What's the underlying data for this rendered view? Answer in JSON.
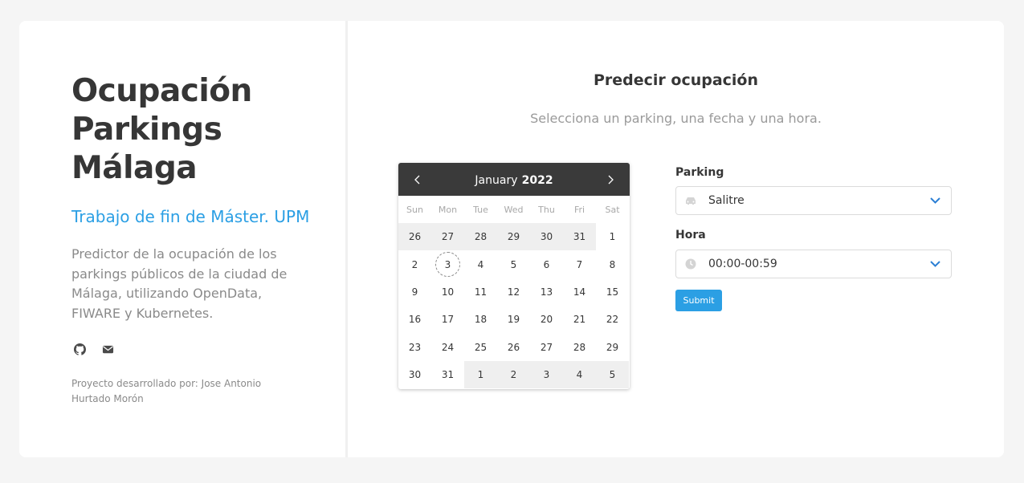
{
  "left": {
    "title": "Ocupación Parkings Málaga",
    "subtitle": "Trabajo de fin de Máster. UPM",
    "description": "Predictor de la ocupación de los parkings públicos de la ciudad de Málaga, utilizando OpenData, FIWARE y Kubernetes.",
    "icons": [
      "github-icon",
      "mail-icon"
    ],
    "credit": "Proyecto desarrollado por: Jose Antonio Hurtado Morón"
  },
  "main": {
    "title": "Predecir ocupación",
    "subtitle": "Selecciona un parking, una fecha y una hora."
  },
  "calendar": {
    "month": "January",
    "year": "2022",
    "weekdays": [
      "Sun",
      "Mon",
      "Tue",
      "Wed",
      "Thu",
      "Fri",
      "Sat"
    ],
    "days": [
      {
        "d": "26",
        "other": true
      },
      {
        "d": "27",
        "other": true
      },
      {
        "d": "28",
        "other": true
      },
      {
        "d": "29",
        "other": true
      },
      {
        "d": "30",
        "other": true
      },
      {
        "d": "31",
        "other": true
      },
      {
        "d": "1"
      },
      {
        "d": "2"
      },
      {
        "d": "3",
        "today": true
      },
      {
        "d": "4"
      },
      {
        "d": "5"
      },
      {
        "d": "6"
      },
      {
        "d": "7"
      },
      {
        "d": "8"
      },
      {
        "d": "9"
      },
      {
        "d": "10"
      },
      {
        "d": "11"
      },
      {
        "d": "12"
      },
      {
        "d": "13"
      },
      {
        "d": "14"
      },
      {
        "d": "15"
      },
      {
        "d": "16"
      },
      {
        "d": "17"
      },
      {
        "d": "18"
      },
      {
        "d": "19"
      },
      {
        "d": "20"
      },
      {
        "d": "21"
      },
      {
        "d": "22"
      },
      {
        "d": "23"
      },
      {
        "d": "24"
      },
      {
        "d": "25"
      },
      {
        "d": "26"
      },
      {
        "d": "27"
      },
      {
        "d": "28"
      },
      {
        "d": "29"
      },
      {
        "d": "30"
      },
      {
        "d": "31"
      },
      {
        "d": "1",
        "other": true
      },
      {
        "d": "2",
        "other": true
      },
      {
        "d": "3",
        "other": true
      },
      {
        "d": "4",
        "other": true
      },
      {
        "d": "5",
        "other": true
      }
    ]
  },
  "form": {
    "parking_label": "Parking",
    "parking_value": "Salitre",
    "parking_icon": "car-icon",
    "hora_label": "Hora",
    "hora_value": "00:00-00:59",
    "hora_icon": "clock-icon",
    "submit_label": "Submit"
  },
  "colors": {
    "accent": "#2b9fe4",
    "calendar_header": "#3a3a3a",
    "background": "#f5f5f5"
  }
}
